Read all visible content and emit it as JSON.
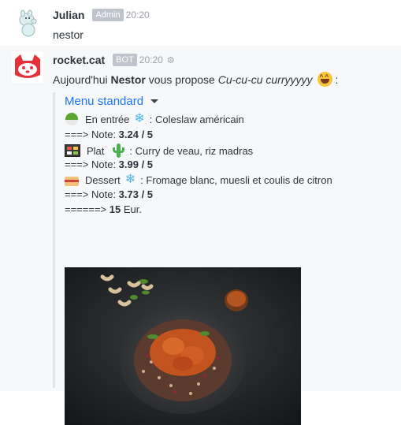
{
  "messages": [
    {
      "user": "Julian",
      "role": "Admin",
      "time": "20:20",
      "text": "nestor"
    },
    {
      "user": "rocket.cat",
      "role": "BOT",
      "time": "20:20",
      "text_prefix": "Aujourd'hui ",
      "text_bold": "Nestor",
      "text_mid": " vous propose ",
      "text_italic": "Cu-cu-cu curryyyyy",
      "text_suffix": ":",
      "attachment": {
        "title": "Menu standard",
        "entree_label": "En entrée",
        "entree_dish": ": Coleslaw américain",
        "entree_note_prefix": "===> Note: ",
        "entree_note": "3.24 / 5",
        "plat_label": "Plat",
        "plat_dish": ": Curry de veau, riz madras",
        "plat_note_prefix": "===> Note: ",
        "plat_note": "3.99 / 5",
        "dessert_label": "Dessert",
        "dessert_dish": ": Fromage blanc, muesli et coulis de citron",
        "dessert_note_prefix": "===> Note: ",
        "dessert_note": "3.73 / 5",
        "price_prefix": "======> ",
        "price_value": "15",
        "price_suffix": " Eur."
      }
    }
  ],
  "colors": {
    "link": "#1d74f5",
    "bot_avatar": "#e4313a",
    "badge": "#bfc4cc",
    "attachment_border": "#e1e5e8"
  },
  "icons": [
    "moomin-avatar",
    "rocket-cat-avatar",
    "settings-gear-icon",
    "laughing-emoji-icon",
    "salad-icon",
    "snowflake-icon",
    "bento-icon",
    "cactus-icon",
    "cake-icon",
    "chevron-down-icon"
  ]
}
